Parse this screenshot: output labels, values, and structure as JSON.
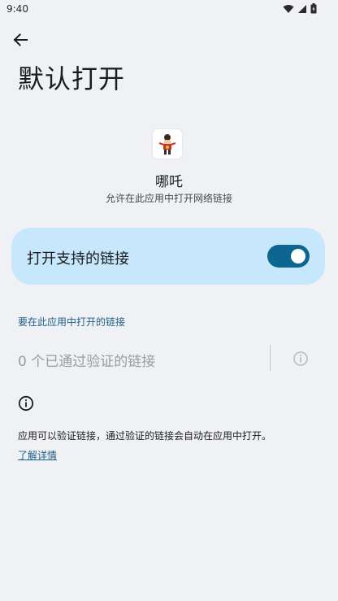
{
  "status_bar": {
    "time": "9:40",
    "icons": [
      "wifi-icon",
      "cell-signal-icon",
      "battery-icon"
    ]
  },
  "header": {
    "back_icon": "arrow-back-icon",
    "title": "默认打开"
  },
  "app": {
    "icon": "nezha-app-icon",
    "name": "哪吒",
    "subtitle": "允许在此应用中打开网络链接"
  },
  "toggle_card": {
    "label": "打开支持的链接",
    "enabled": true,
    "colors": {
      "card_bg": "#c7e7fc",
      "switch_on": "#0d6690"
    }
  },
  "links_section": {
    "header": "要在此应用中打开的链接",
    "verified_links": "0 个已通过验证的链接",
    "info_icon": "info-outline-icon"
  },
  "footer": {
    "info_icon": "info-icon",
    "text": "应用可以验证链接，通过验证的链接会自动在应用中打开。",
    "learn_more": "了解详情"
  }
}
